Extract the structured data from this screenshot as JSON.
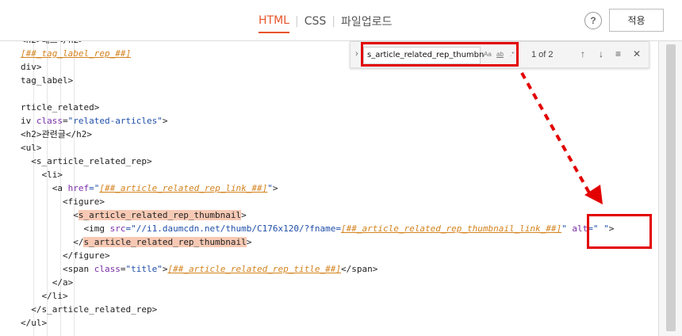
{
  "header": {
    "tabs": [
      {
        "label": "HTML",
        "active": true
      },
      {
        "label": "CSS",
        "active": false
      },
      {
        "label": "파일업로드",
        "active": false
      }
    ],
    "help_label": "?",
    "apply_label": "적용"
  },
  "find": {
    "toggle_icon": "chevron-right-icon",
    "query": "s_article_related_rep_thumbn",
    "match_case_label": "Aa",
    "whole_word_label": "ab",
    "regex_label": ".*",
    "count_text": "1 of 2",
    "prev_icon": "arrow-up-icon",
    "next_icon": "arrow-down-icon",
    "selection_icon": "find-in-selection-icon",
    "close_icon": "close-icon"
  },
  "code_lines": [
    {
      "indent": "",
      "parts": [
        {
          "t": "<h2>태그</h2>"
        }
      ]
    },
    {
      "indent": "",
      "parts": [
        {
          "t": "[##_tag_label_rep_##]",
          "c": "tpl"
        }
      ]
    },
    {
      "indent": "",
      "parts": [
        {
          "t": "div>"
        }
      ]
    },
    {
      "indent": "",
      "parts": [
        {
          "t": "tag_label>"
        }
      ]
    },
    {
      "indent": "",
      "parts": [
        {
          "t": ""
        }
      ]
    },
    {
      "indent": "",
      "parts": [
        {
          "t": "rticle_related>"
        }
      ]
    },
    {
      "indent": "",
      "parts": [
        {
          "t": "iv "
        },
        {
          "t": "class",
          "c": "attr"
        },
        {
          "t": "="
        },
        {
          "t": "\"related-articles\"",
          "c": "val"
        },
        {
          "t": ">"
        }
      ]
    },
    {
      "indent": "",
      "parts": [
        {
          "t": "<h2>관련글</h2>"
        }
      ]
    },
    {
      "indent": "",
      "parts": [
        {
          "t": "<ul>"
        }
      ]
    },
    {
      "indent": "  ",
      "parts": [
        {
          "t": "<s_article_related_rep>"
        }
      ]
    },
    {
      "indent": "    ",
      "parts": [
        {
          "t": "<li>"
        }
      ]
    },
    {
      "indent": "      ",
      "parts": [
        {
          "t": "<a "
        },
        {
          "t": "href",
          "c": "attr"
        },
        {
          "t": "=\"",
          "c": "val"
        },
        {
          "t": "[##_article_related_rep_link_##]",
          "c": "tpl"
        },
        {
          "t": "\"",
          "c": "val"
        },
        {
          "t": ">"
        }
      ]
    },
    {
      "indent": "        ",
      "parts": [
        {
          "t": "<figure>"
        }
      ]
    },
    {
      "indent": "          ",
      "parts": [
        {
          "t": "<"
        },
        {
          "t": "s_article_related_rep_thumbnail",
          "c": "hl"
        },
        {
          "t": ">"
        }
      ]
    },
    {
      "indent": "            ",
      "parts": [
        {
          "t": "<img "
        },
        {
          "t": "src",
          "c": "attr"
        },
        {
          "t": "=\"//i1.daumcdn.net/thumb/C176x120/?fname=",
          "c": "val"
        },
        {
          "t": "[##_article_related_rep_thumbnail_link_##]",
          "c": "tpl"
        },
        {
          "t": "\" ",
          "c": "val"
        },
        {
          "t": "alt",
          "c": "attr"
        },
        {
          "t": "=\" \"",
          "c": "val"
        },
        {
          "t": ">"
        }
      ]
    },
    {
      "indent": "          ",
      "parts": [
        {
          "t": "</"
        },
        {
          "t": "s_article_related_rep_thumbnail",
          "c": "hl"
        },
        {
          "t": ">"
        }
      ]
    },
    {
      "indent": "        ",
      "parts": [
        {
          "t": "</figure>"
        }
      ]
    },
    {
      "indent": "        ",
      "parts": [
        {
          "t": "<span "
        },
        {
          "t": "class",
          "c": "attr"
        },
        {
          "t": "="
        },
        {
          "t": "\"title\"",
          "c": "val"
        },
        {
          "t": ">"
        },
        {
          "t": "[##_article_related_rep_title_##]",
          "c": "tpl"
        },
        {
          "t": "</span>"
        }
      ]
    },
    {
      "indent": "      ",
      "parts": [
        {
          "t": "</a>"
        }
      ]
    },
    {
      "indent": "    ",
      "parts": [
        {
          "t": "</li>"
        }
      ]
    },
    {
      "indent": "  ",
      "parts": [
        {
          "t": "</s_article_related_rep>"
        }
      ]
    },
    {
      "indent": "",
      "parts": [
        {
          "t": "</ul>"
        }
      ]
    }
  ],
  "colors": {
    "accent": "#e8542b",
    "annotation_red": "#e30000",
    "match_highlight": "#f7c9b4",
    "template_var": "#d4831e",
    "attribute": "#7a2da8",
    "string": "#1f4ea8"
  }
}
